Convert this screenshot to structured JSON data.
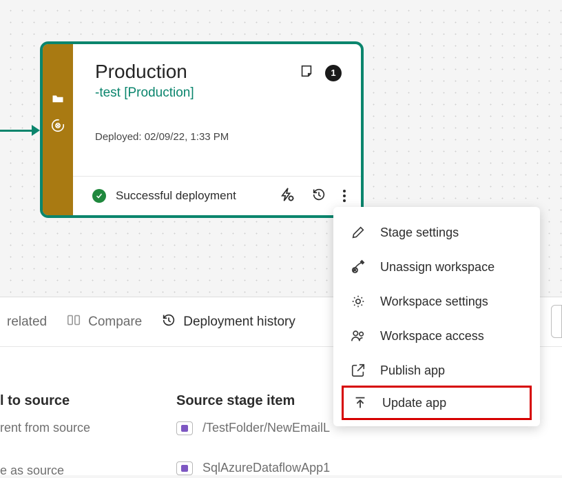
{
  "stage": {
    "title": "Production",
    "subtitle": "-test [Production]",
    "deployed_label": "Deployed: 02/09/22, 1:33 PM",
    "status_text": "Successful deployment",
    "count": "1"
  },
  "menu": {
    "items": [
      {
        "label": "Stage settings"
      },
      {
        "label": "Unassign workspace"
      },
      {
        "label": "Workspace settings"
      },
      {
        "label": "Workspace access"
      },
      {
        "label": "Publish app"
      },
      {
        "label": "Update app"
      }
    ]
  },
  "toolbar": {
    "related": "related",
    "compare": "Compare",
    "history": "Deployment history"
  },
  "table": {
    "header_a": "l to source",
    "header_b": "Source stage item",
    "row1_a": "rent from source",
    "row1_b": "/TestFolder/NewEmailL",
    "row2_a": "e as source",
    "row2_b": "SqlAzureDataflowApp1"
  }
}
